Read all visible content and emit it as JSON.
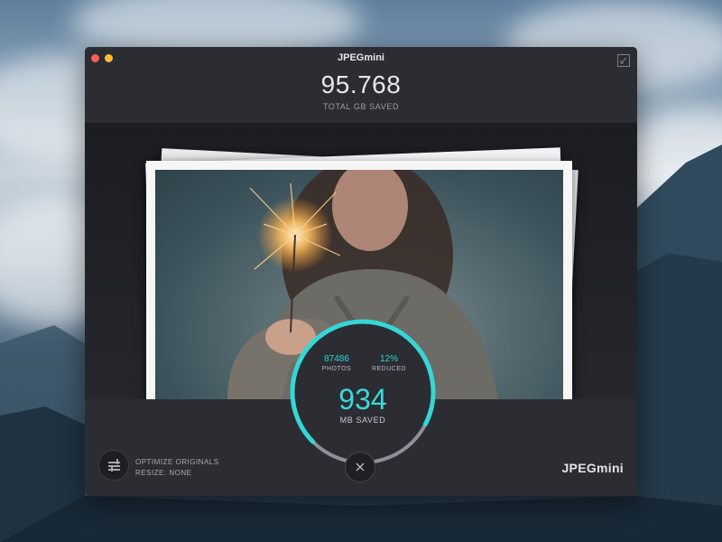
{
  "window": {
    "title": "JPEGmini",
    "total_saved_value": "95.768",
    "total_saved_label": "TOTAL GB SAVED"
  },
  "stats": {
    "photos_value": "87486",
    "photos_label": "PHOTOS",
    "reduced_value": "12%",
    "reduced_label": "REDUCED",
    "mb_saved_value": "934",
    "mb_saved_label": "MB SAVED",
    "progress_fraction": 0.7
  },
  "footer": {
    "option_line1": "OPTIMIZE ORIGINALS",
    "option_line2": "RESIZE: NONE",
    "brand": "JPEGmini"
  },
  "icons": {
    "settings": "sliders-icon",
    "cancel": "close-icon",
    "window_shrink": "shrink-icon"
  },
  "colors": {
    "accent": "#35d6d6",
    "window_bg": "#2b2d33",
    "close_light": "#fc5c57",
    "minimize_light": "#fdbb2e"
  }
}
